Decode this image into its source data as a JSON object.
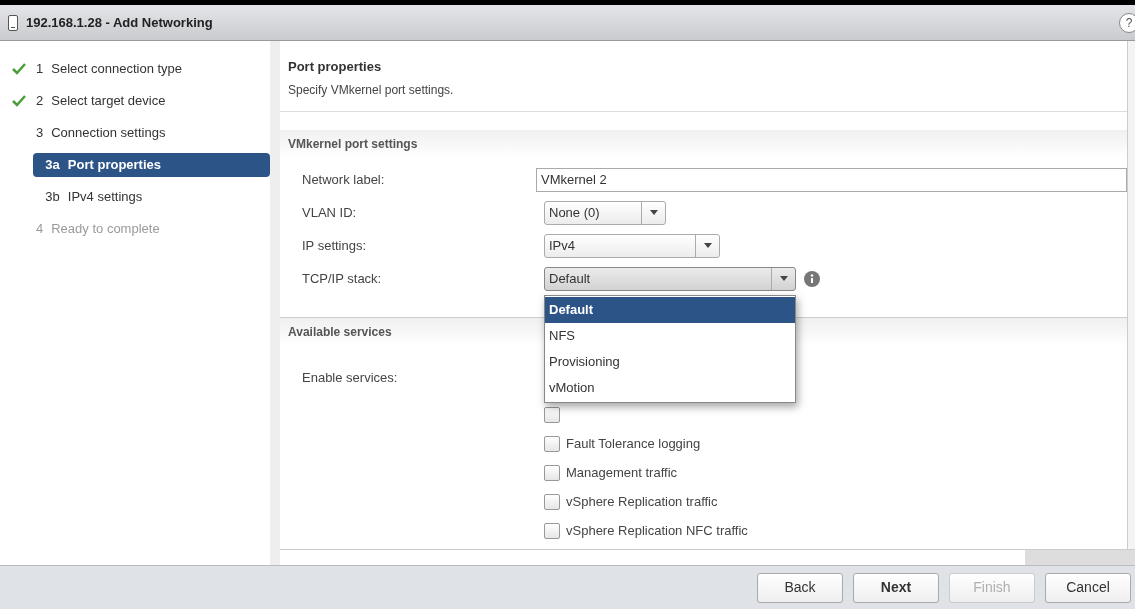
{
  "window": {
    "title": "192.168.1.28 - Add Networking",
    "help": "?"
  },
  "steps": [
    {
      "number": "1",
      "label": "Select connection type",
      "done": true,
      "selected": false,
      "disabled": false
    },
    {
      "number": "2",
      "label": "Select target device",
      "done": true,
      "selected": false,
      "disabled": false
    },
    {
      "number": "3",
      "label": "Connection settings",
      "done": false,
      "selected": false,
      "disabled": false,
      "children": [
        {
          "number": "3a",
          "label": "Port properties",
          "selected": true
        },
        {
          "number": "3b",
          "label": "IPv4 settings",
          "selected": false
        }
      ]
    },
    {
      "number": "4",
      "label": "Ready to complete",
      "done": false,
      "selected": false,
      "disabled": true
    }
  ],
  "page": {
    "title": "Port properties",
    "subtitle": "Specify VMkernel port settings."
  },
  "port_settings": {
    "heading": "VMkernel port settings",
    "fields": [
      {
        "kind": "text",
        "label": "Network label:",
        "value": "VMkernel 2"
      },
      {
        "kind": "select",
        "label": "VLAN ID:",
        "value": "None (0)",
        "info": false,
        "open": false
      },
      {
        "kind": "select",
        "label": "IP settings:",
        "value": "IPv4",
        "info": false,
        "open": false
      },
      {
        "kind": "select",
        "label": "TCP/IP stack:",
        "value": "Default",
        "info": true,
        "open": true
      }
    ]
  },
  "dropdown": {
    "options": [
      {
        "label": "Default",
        "selected": true
      },
      {
        "label": "NFS",
        "selected": false
      },
      {
        "label": "Provisioning",
        "selected": false
      },
      {
        "label": "vMotion",
        "selected": false
      }
    ]
  },
  "services": {
    "heading": "Available services",
    "label": "Enable services:",
    "items": [
      {
        "checked": false
      },
      {
        "label": "Fault Tolerance logging",
        "checked": false
      },
      {
        "label": "Management traffic",
        "checked": false
      },
      {
        "label": "vSphere Replication traffic",
        "checked": false
      },
      {
        "label": "vSphere Replication NFC traffic",
        "checked": false
      }
    ]
  },
  "buttons": [
    {
      "label": "Back",
      "primary": false,
      "disabled": false
    },
    {
      "label": "Next",
      "primary": true,
      "disabled": false
    },
    {
      "label": "Finish",
      "primary": false,
      "disabled": true
    },
    {
      "label": "Cancel",
      "primary": false,
      "disabled": false
    }
  ]
}
